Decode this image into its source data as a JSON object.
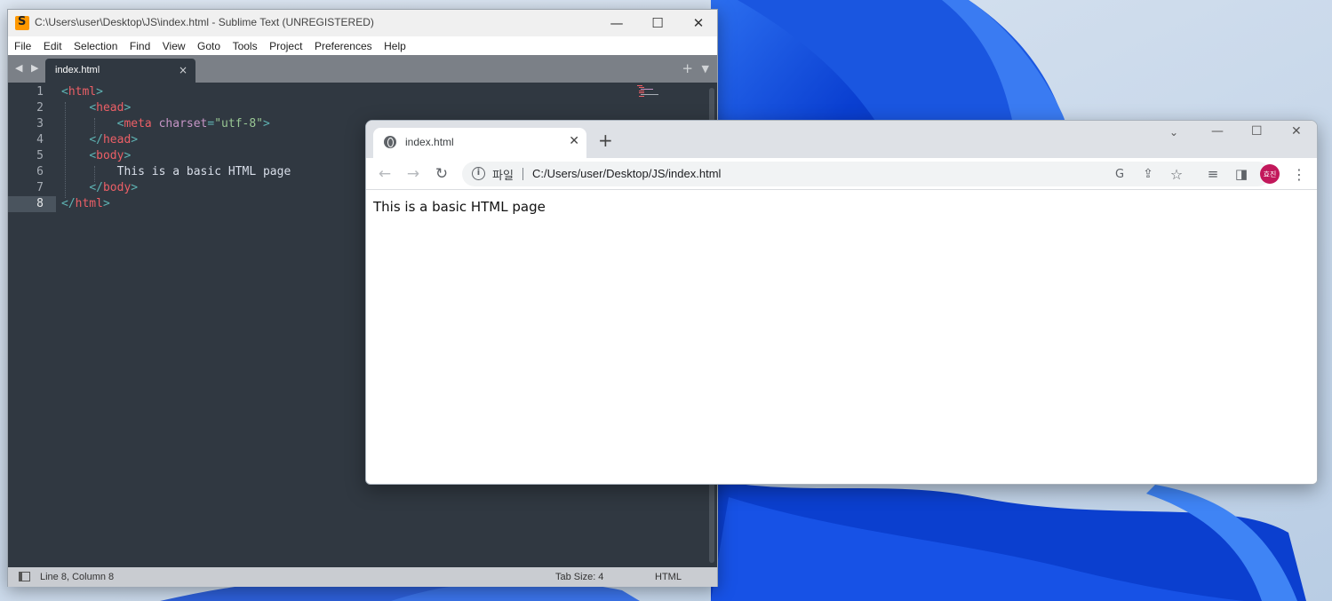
{
  "sublime": {
    "title": "C:\\Users\\user\\Desktop\\JS\\index.html - Sublime Text (UNREGISTERED)",
    "menu": [
      "File",
      "Edit",
      "Selection",
      "Find",
      "View",
      "Goto",
      "Tools",
      "Project",
      "Preferences",
      "Help"
    ],
    "tab_label": "index.html",
    "line_numbers": [
      "1",
      "2",
      "3",
      "4",
      "5",
      "6",
      "7",
      "8"
    ],
    "code": {
      "l1_tag": "html",
      "l2_tag": "head",
      "l3_tag": "meta",
      "l3_attr": "charset",
      "l3_value": "\"utf-8\"",
      "l4_tag": "head",
      "l5_tag": "body",
      "l6_text": "This is a basic HTML page",
      "l7_tag": "body",
      "l8_tag": "html"
    },
    "status": {
      "position": "Line 8, Column 8",
      "tab_size": "Tab Size: 4",
      "syntax": "HTML"
    }
  },
  "chrome": {
    "tab_label": "index.html",
    "address_scheme": "파일",
    "address_url": "C:/Users/user/Desktop/JS/index.html",
    "profile_initials": "효진",
    "page_text": "This is a basic HTML page"
  },
  "colors": {
    "sublime_bg": "#303841",
    "tag": "#ec5f66",
    "attribute": "#c695c6",
    "string": "#99c794",
    "avatar": "#c2185b"
  }
}
